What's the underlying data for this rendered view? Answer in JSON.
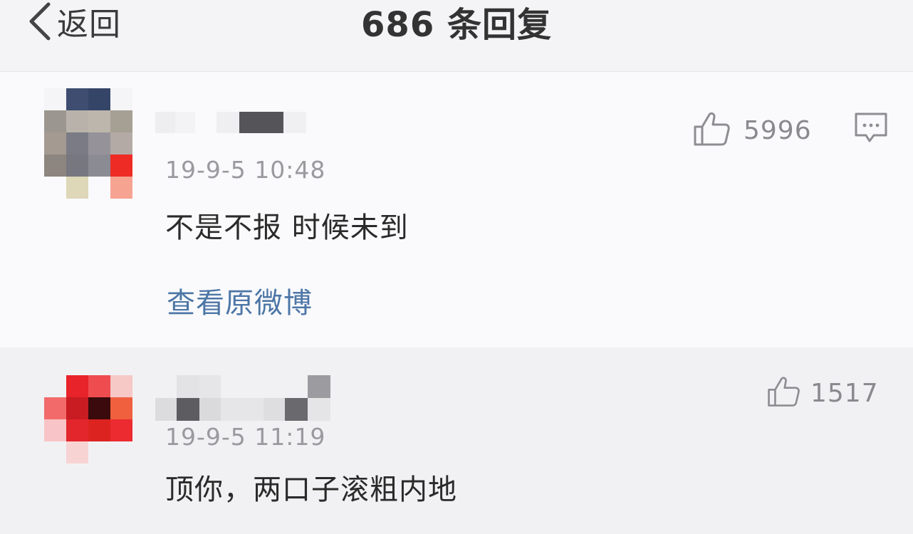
{
  "header": {
    "back_label": "返回",
    "title": "686 条回复"
  },
  "main_comment": {
    "time": "19-9-5 10:48",
    "content": "不是不报 时候未到",
    "like_count": "5996",
    "view_original_label": "查看原微博"
  },
  "reply": {
    "time": "19-9-5 11:19",
    "content": "顶你，两口子滚粗内地",
    "like_count": "1517"
  },
  "icons": {
    "back": "chevron-left-icon",
    "like": "thumbs-up-icon",
    "comment": "comment-icon"
  },
  "colors": {
    "link": "#4d76a6",
    "muted": "#9a9a9e"
  }
}
